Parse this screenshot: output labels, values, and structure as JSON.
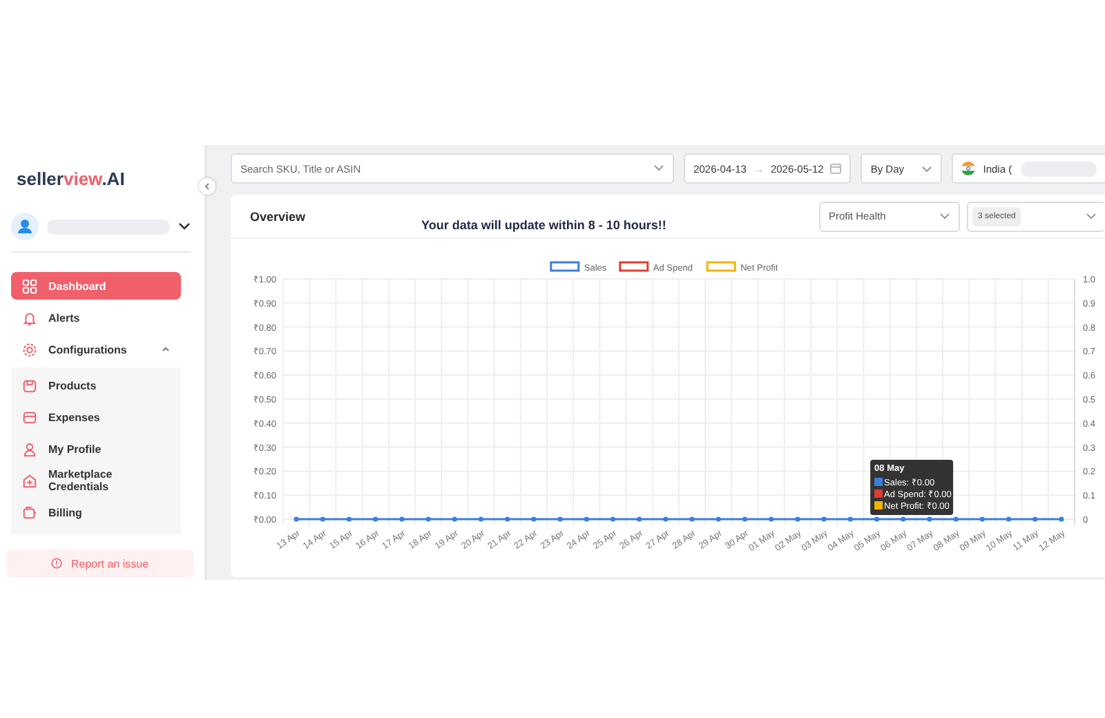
{
  "sidebar": {
    "logo": {
      "text": "seller",
      "accent": "view",
      "suffix": ".AI"
    },
    "items": [
      {
        "label": "Dashboard",
        "selected": true
      },
      {
        "label": "Alerts",
        "selected": false
      },
      {
        "label": "Configurations",
        "selected": false,
        "expanded": true,
        "children": [
          {
            "label": "Products",
            "selected": false
          },
          {
            "label": "Expenses",
            "selected": false
          },
          {
            "label": "My Profile",
            "selected": false
          },
          {
            "label": "Marketplace Credentials",
            "selected": false
          },
          {
            "label": "Billing",
            "selected": false
          }
        ]
      }
    ],
    "report_button": "Report an issue"
  },
  "filters": {
    "search": {
      "placeholder": "Search SKU, Title or ASIN"
    },
    "date_from": "2026-04-13",
    "date_separator": "→",
    "date_to": "2026-05-12",
    "granularity": "By Day",
    "country": "India ("
  },
  "overview": {
    "title": "Overview",
    "banner": "Your data will update within 8 - 10 hours!!",
    "metric_select": "Profit Health",
    "series_select": "3 selected",
    "chart_data": {
      "type": "line",
      "grid": true,
      "legend": true,
      "categories": [
        "13 Apr",
        "14 Apr",
        "15 Apr",
        "16 Apr",
        "17 Apr",
        "18 Apr",
        "19 Apr",
        "20 Apr",
        "21 Apr",
        "22 Apr",
        "23 Apr",
        "24 Apr",
        "25 Apr",
        "26 Apr",
        "27 Apr",
        "28 Apr",
        "29 Apr",
        "30 Apr",
        "01 May",
        "02 May",
        "03 May",
        "04 May",
        "05 May",
        "06 May",
        "07 May",
        "08 May",
        "09 May",
        "10 May",
        "11 May",
        "12 May"
      ],
      "series": [
        {
          "name": "Sales",
          "color": "#3b7ddd",
          "marker": "circle",
          "values": [
            0,
            0,
            0,
            0,
            0,
            0,
            0,
            0,
            0,
            0,
            0,
            0,
            0,
            0,
            0,
            0,
            0,
            0,
            0,
            0,
            0,
            0,
            0,
            0,
            0,
            0,
            0,
            0,
            0,
            0
          ]
        },
        {
          "name": "Ad Spend",
          "color": "#e03c31",
          "values": [
            null,
            null,
            null,
            null,
            null,
            null,
            null,
            null,
            null,
            null,
            null,
            null,
            null,
            null,
            null,
            null,
            null,
            null,
            null,
            null,
            null,
            null,
            null,
            null,
            null,
            null,
            null,
            null,
            null,
            null
          ]
        },
        {
          "name": "Net Profit",
          "color": "#f5b400",
          "values": [
            null,
            null,
            null,
            null,
            null,
            null,
            null,
            null,
            null,
            null,
            null,
            null,
            null,
            null,
            null,
            null,
            null,
            null,
            null,
            null,
            null,
            null,
            null,
            null,
            null,
            null,
            null,
            null,
            null,
            null
          ]
        }
      ],
      "ylim": [
        0,
        1
      ],
      "yticks": [
        {
          "value": 0,
          "label": "₹0.00"
        },
        {
          "value": 0.1,
          "label": "₹0.10"
        },
        {
          "value": 0.2,
          "label": "₹0.20"
        },
        {
          "value": 0.3,
          "label": "₹0.30"
        },
        {
          "value": 0.4,
          "label": "₹0.40"
        },
        {
          "value": 0.5,
          "label": "₹0.50"
        },
        {
          "value": 0.6,
          "label": "₹0.60"
        },
        {
          "value": 0.7,
          "label": "₹0.70"
        },
        {
          "value": 0.8,
          "label": "₹0.80"
        },
        {
          "value": 0.9,
          "label": "₹0.90"
        },
        {
          "value": 1,
          "label": "₹1.00"
        }
      ]
    },
    "right_axis_ticks": [
      "1.0",
      "0.9",
      "0.8",
      "0.7",
      "0.6",
      "0.5",
      "0.4",
      "0.3",
      "0.2",
      "0.1",
      "0"
    ],
    "tooltip": {
      "title": "08 May",
      "items": [
        {
          "text": "Sales: ₹0.00",
          "color": "#3b7ddd"
        },
        {
          "text": "Ad Spend: ₹0.00",
          "color": "#e03c31"
        },
        {
          "text": "Net Profit: ₹0.00",
          "color": "#f5b400"
        }
      ]
    }
  }
}
